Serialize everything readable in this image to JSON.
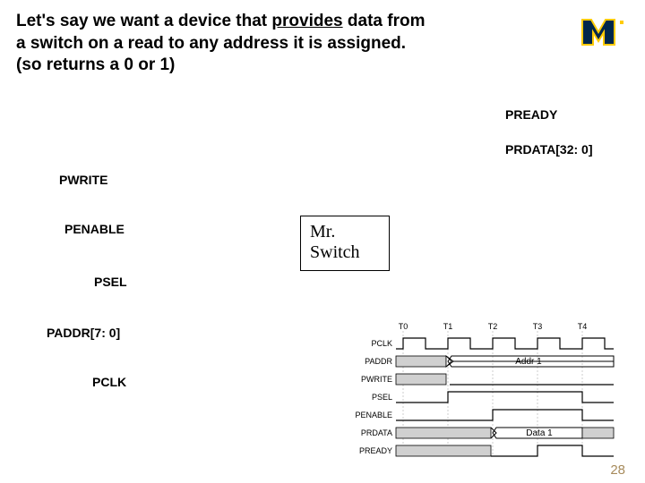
{
  "title": {
    "line1_pre": "Let's say we want a device that ",
    "line1_u": "provides",
    "line1_post": " data from",
    "line2": "a switch on a read to any address it is assigned.",
    "line3": "(so returns a 0 or 1)"
  },
  "logo": {
    "name": "michigan-block-m"
  },
  "signals": {
    "pready": "PREADY",
    "prdata": "PRDATA[32: 0]",
    "pwrite": "PWRITE",
    "penable": "PENABLE",
    "psel": "PSEL",
    "paddr": "PADDR[7: 0]",
    "pclk": "PCLK"
  },
  "box": {
    "line1": "Mr.",
    "line2": "Switch"
  },
  "timing": {
    "ticks": [
      "T0",
      "T1",
      "T2",
      "T3",
      "T4"
    ],
    "rows": [
      "PCLK",
      "PADDR",
      "PWRITE",
      "PSEL",
      "PENABLE",
      "PRDATA",
      "PREADY"
    ],
    "paddr_value": "Addr 1",
    "prdata_value": "Data 1"
  },
  "pagenum": "28"
}
